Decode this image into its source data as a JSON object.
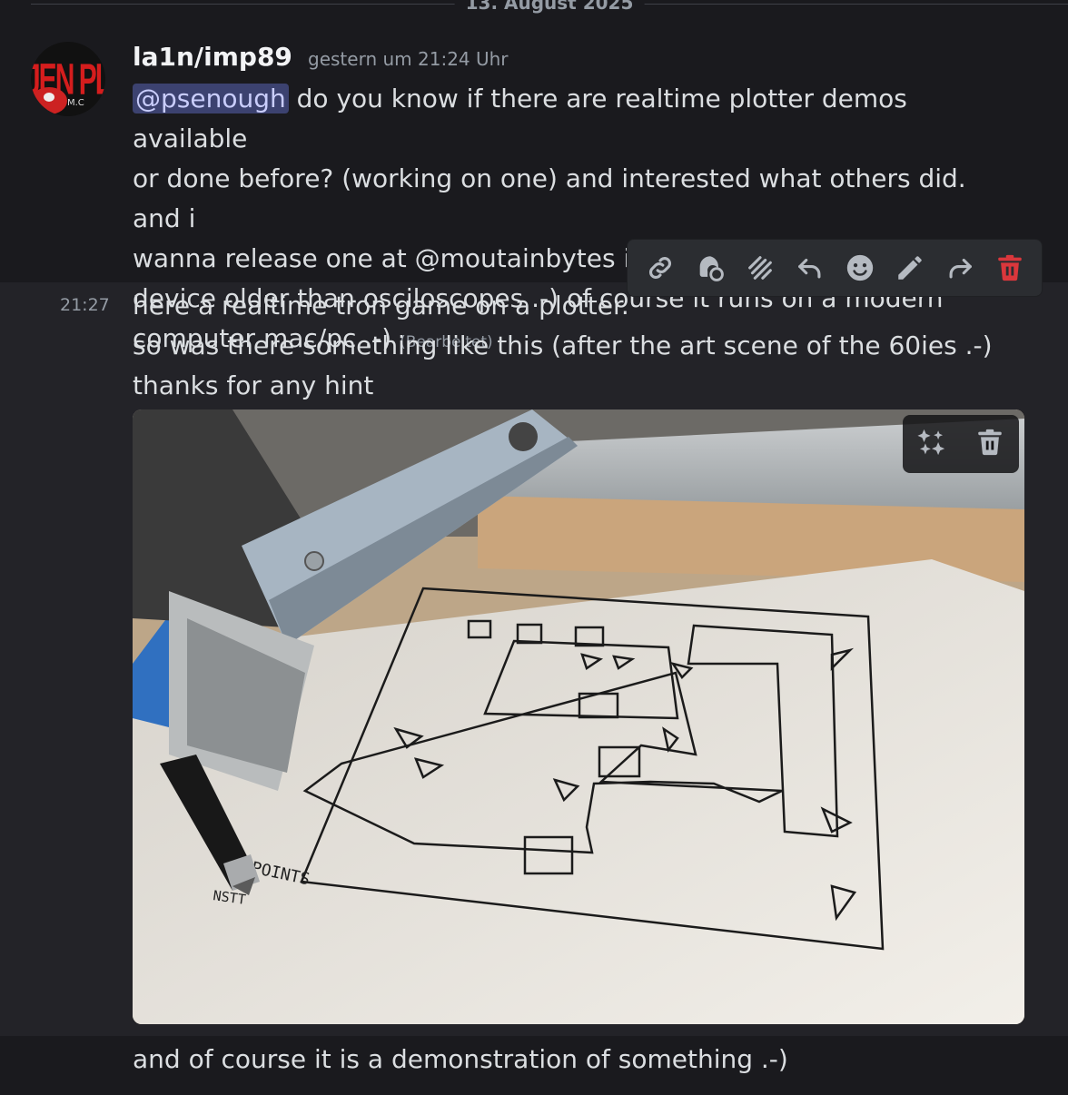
{
  "divider": {
    "date": "13. August 2025"
  },
  "message1": {
    "username": "la1n/imp89",
    "timestamp": "gestern um 21:24 Uhr",
    "mention": "@psenough",
    "line1_rest": " do you know if there are realtime plotter demos available",
    "line2": "or done before? (working on one) and interested what others did. and i",
    "line3": "wanna release one at  @moutainbytes if they allow a real old output",
    "line4": "device older than osciloscopes .-) of course it runs on a modern",
    "line5": "computer mac/pc .-) ",
    "edited": "(Bearbeitet)"
  },
  "message2": {
    "time": "21:27",
    "line1": "here a realtime tron game on a plotter.",
    "line2": "so was there something like this (after the art scene of the 60ies .-)",
    "line3": "thanks for any hint"
  },
  "message3": {
    "text": "and of course it is a demonstration of something .-)"
  },
  "avatar": {
    "text": "JEN PLA",
    "small_text": "M.C"
  },
  "toolbar": {
    "icons": [
      "link-icon",
      "app-icon",
      "thread-icon",
      "reply-icon",
      "reaction-icon",
      "edit-icon",
      "forward-icon",
      "delete-icon"
    ]
  },
  "photo": {
    "score_text": "POINTS",
    "small_text": "NSTT",
    "overlay_icons": [
      "sparkle-icon",
      "trash-icon"
    ]
  },
  "colors": {
    "background": "#1a1a1e",
    "highlight": "#232328",
    "mention_bg": "#3c4270",
    "delete_red": "#da373c"
  }
}
